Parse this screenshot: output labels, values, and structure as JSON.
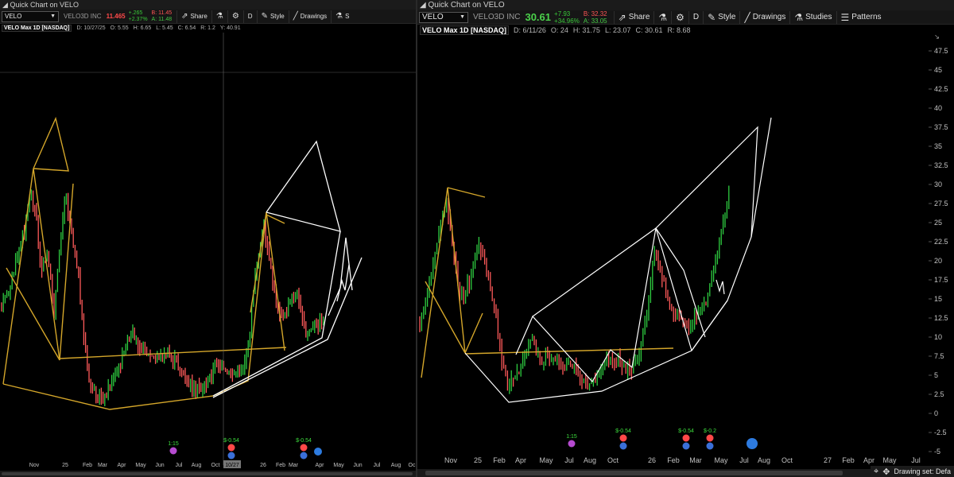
{
  "left": {
    "window_title": "Quick Chart on VELO",
    "symbol": "VELO",
    "company": "VELO3D INC",
    "price": "11.465",
    "change_abs": "+.265",
    "change_pct": "+2.37%",
    "bid": "B: 11.45",
    "ask": "A: 11.48",
    "toolbar": {
      "share": "Share",
      "period": "D",
      "style": "Style",
      "drawings": "Drawings",
      "studies_truncated": "S"
    },
    "info": {
      "title": "VELO Max 1D [NASDAQ]",
      "date": "D: 10/27/25",
      "open": "O: 5.55",
      "high": "H: 6.65",
      "low": "L: 5.45",
      "close": "C: 6.54",
      "range": "R: 1.2",
      "y": "Y: 40.91"
    },
    "crosshair_date": "10/27",
    "x_labels": [
      "Nov",
      "25",
      "Feb",
      "Mar",
      "Apr",
      "May",
      "Jun",
      "Jul",
      "Aug",
      "Oct",
      "26",
      "Feb",
      "Mar",
      "Apr",
      "May",
      "Jun",
      "Jul",
      "Aug",
      "Oc"
    ],
    "events": [
      "1:15",
      "$-0.54",
      "$-0.54"
    ]
  },
  "right": {
    "window_title": "Quick Chart on VELO",
    "symbol": "VELO",
    "company": "VELO3D INC",
    "price": "30.61",
    "change_abs": "+7.93",
    "change_pct": "+34.96%",
    "bid": "B: 32.32",
    "ask": "A: 33.05",
    "toolbar": {
      "share": "Share",
      "period": "D",
      "style": "Style",
      "drawings": "Drawings",
      "studies": "Studies",
      "patterns": "Patterns"
    },
    "info": {
      "title": "VELO Max 1D [NASDAQ]",
      "date": "D: 6/11/26",
      "open": "O: 24",
      "high": "H: 31.75",
      "low": "L: 23.07",
      "close": "C: 30.61",
      "range": "R: 8.68"
    },
    "y_labels": [
      "47.5",
      "45",
      "42.5",
      "40",
      "37.5",
      "35",
      "32.5",
      "30",
      "27.5",
      "25",
      "22.5",
      "20",
      "17.5",
      "15",
      "12.5",
      "10",
      "7.5",
      "5",
      "2.5",
      "0",
      "-2.5",
      "-5"
    ],
    "x_labels": [
      "Nov",
      "25",
      "Feb",
      "Apr",
      "May",
      "Jul",
      "Aug",
      "Oct",
      "26",
      "Feb",
      "Mar",
      "May",
      "Jul",
      "Aug",
      "Oct",
      "27",
      "Feb",
      "Apr",
      "May",
      "Jul"
    ],
    "events": [
      "1:15",
      "$-0.54",
      "$-0.54",
      "$-0.2"
    ],
    "drawing_set": "Drawing set: Defa"
  },
  "colors": {
    "up": "#2ecc40",
    "down": "#ff5a5a",
    "gold": "#d4a62a",
    "white_line": "#ffffff",
    "grid": "#2b2b2b"
  },
  "icons": [
    "share-icon",
    "flask-icon",
    "gear-icon",
    "brush-icon",
    "pencil-icon",
    "studies-icon",
    "patterns-icon",
    "crosshair-icon",
    "move-icon"
  ]
}
